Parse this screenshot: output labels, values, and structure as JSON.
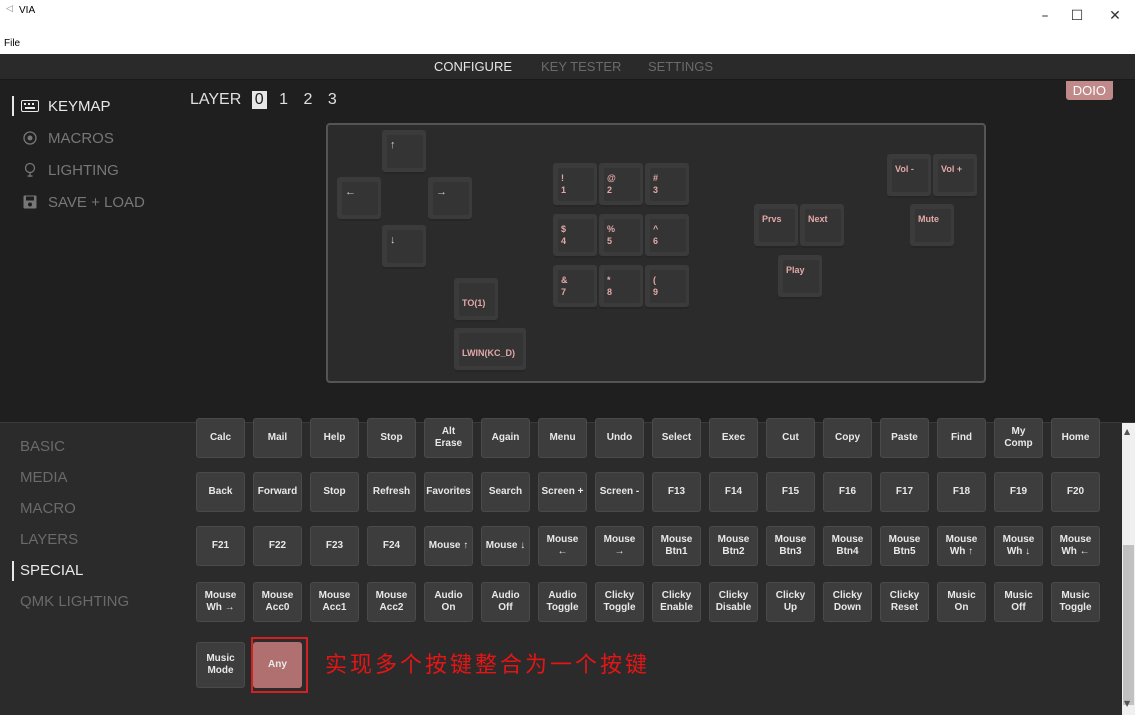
{
  "window": {
    "title": "VIA",
    "minimize": "–",
    "maximize": "☐",
    "close": "✕"
  },
  "menubar": {
    "file": "File"
  },
  "topnav": {
    "tabs": [
      {
        "label": "CONFIGURE",
        "active": true
      },
      {
        "label": "KEY TESTER",
        "active": false
      },
      {
        "label": "SETTINGS",
        "active": false
      }
    ]
  },
  "leftnav": {
    "items": [
      {
        "label": "KEYMAP",
        "icon": "keyboard-icon",
        "active": true
      },
      {
        "label": "MACROS",
        "icon": "record-icon",
        "active": false
      },
      {
        "label": "LIGHTING",
        "icon": "bulb-icon",
        "active": false
      },
      {
        "label": "SAVE + LOAD",
        "icon": "save-icon",
        "active": false
      }
    ]
  },
  "layers": {
    "label": "LAYER",
    "options": [
      "0",
      "1",
      "2",
      "3"
    ],
    "selected": "0"
  },
  "device_badge": "DOIO",
  "keymap": [
    {
      "legend": "↑",
      "style": "white"
    },
    {
      "legend": "←",
      "style": "white"
    },
    {
      "legend": "→",
      "style": "white"
    },
    {
      "legend": "↓",
      "style": "white"
    },
    {
      "legend": "TO(1)",
      "style": "accent"
    },
    {
      "legend": "LWIN(KC_D)",
      "style": "accent"
    },
    {
      "legend": "!\n1",
      "style": "accent"
    },
    {
      "legend": "@\n2",
      "style": "accent"
    },
    {
      "legend": "#\n3",
      "style": "accent"
    },
    {
      "legend": "$\n4",
      "style": "accent"
    },
    {
      "legend": "%\n5",
      "style": "accent"
    },
    {
      "legend": "^\n6",
      "style": "accent"
    },
    {
      "legend": "&\n7",
      "style": "accent"
    },
    {
      "legend": "*\n8",
      "style": "accent"
    },
    {
      "legend": "(\n9",
      "style": "accent"
    },
    {
      "legend": "Prvs",
      "style": "accent"
    },
    {
      "legend": "Next",
      "style": "accent"
    },
    {
      "legend": "Play",
      "style": "accent"
    },
    {
      "legend": "Vol -",
      "style": "accent"
    },
    {
      "legend": "Vol +",
      "style": "accent"
    },
    {
      "legend": "Mute",
      "style": "accent"
    }
  ],
  "categories": {
    "items": [
      {
        "label": "BASIC",
        "active": false
      },
      {
        "label": "MEDIA",
        "active": false
      },
      {
        "label": "MACRO",
        "active": false
      },
      {
        "label": "LAYERS",
        "active": false
      },
      {
        "label": "SPECIAL",
        "active": true
      },
      {
        "label": "QMK LIGHTING",
        "active": false
      }
    ]
  },
  "keycodes": [
    [
      "Calc",
      "Mail",
      "Help",
      "Stop",
      "Alt\nErase",
      "Again",
      "Menu",
      "Undo",
      "Select",
      "Exec",
      "Cut",
      "Copy",
      "Paste",
      "Find",
      "My\nComp",
      "Home"
    ],
    [
      "Back",
      "Forward",
      "Stop",
      "Refresh",
      "Favorites",
      "Search",
      "Screen +",
      "Screen -",
      "F13",
      "F14",
      "F15",
      "F16",
      "F17",
      "F18",
      "F19",
      "F20"
    ],
    [
      "F21",
      "F22",
      "F23",
      "F24",
      "Mouse ↑",
      "Mouse ↓",
      "Mouse\n←",
      "Mouse\n→",
      "Mouse\nBtn1",
      "Mouse\nBtn2",
      "Mouse\nBtn3",
      "Mouse\nBtn4",
      "Mouse\nBtn5",
      "Mouse\nWh ↑",
      "Mouse\nWh ↓",
      "Mouse\nWh ←"
    ],
    [
      "Mouse\nWh →",
      "Mouse\nAcc0",
      "Mouse\nAcc1",
      "Mouse\nAcc2",
      "Audio\nOn",
      "Audio\nOff",
      "Audio\nToggle",
      "Clicky\nToggle",
      "Clicky\nEnable",
      "Clicky\nDisable",
      "Clicky\nUp",
      "Clicky\nDown",
      "Clicky\nReset",
      "Music\nOn",
      "Music\nOff",
      "Music\nToggle"
    ],
    [
      "Music\nMode",
      "Any"
    ]
  ],
  "annotation": "实现多个按键整合为一个按键",
  "colors": {
    "accent_legend": "#e3a8a8",
    "badge": "#c08a8a",
    "any_key": "#b07070",
    "annotation": "#e51515"
  }
}
